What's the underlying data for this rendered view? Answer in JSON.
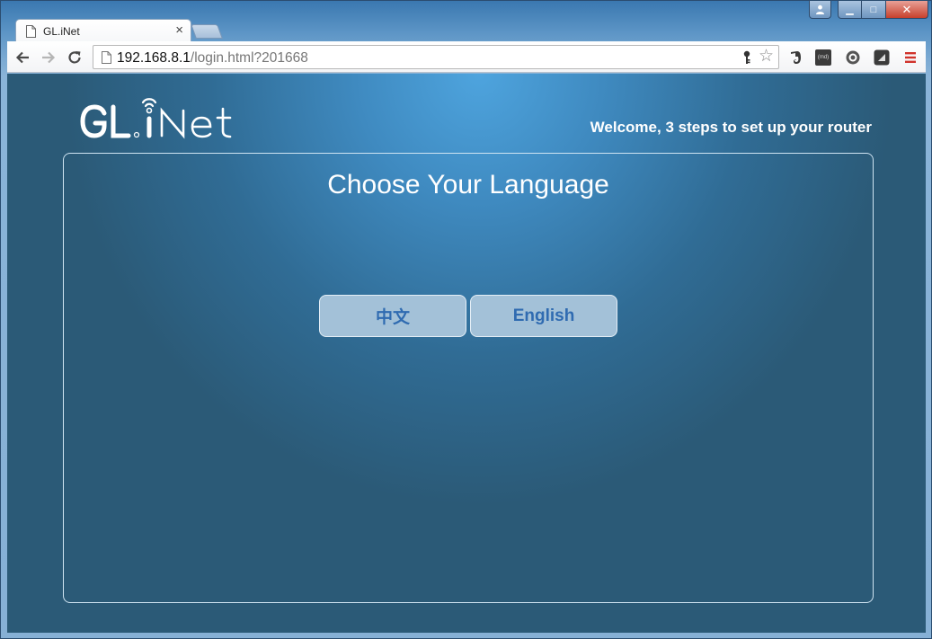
{
  "browser": {
    "tab": {
      "title": "GL.iNet",
      "close_glyph": "×"
    },
    "url": {
      "host": "192.168.8.1",
      "path": "/login.html?201668"
    },
    "window_controls": {
      "minimize": "▁",
      "maximize": "□",
      "close": "✕"
    },
    "extensions": [
      "evernote-icon",
      "markdown-icon",
      "circle-icon",
      "square-icon",
      "menu-icon"
    ],
    "markdown_badge": "(md)"
  },
  "page": {
    "logo_text": "GL.iNet",
    "welcome": "Welcome, 3 steps to set up your router",
    "title": "Choose Your Language",
    "languages": [
      {
        "label": "中文"
      },
      {
        "label": "English"
      }
    ]
  },
  "colors": {
    "background": "#306c95",
    "button_bg": "#a3c1d8",
    "button_text": "#2f6bb1",
    "text": "#ffffff"
  }
}
